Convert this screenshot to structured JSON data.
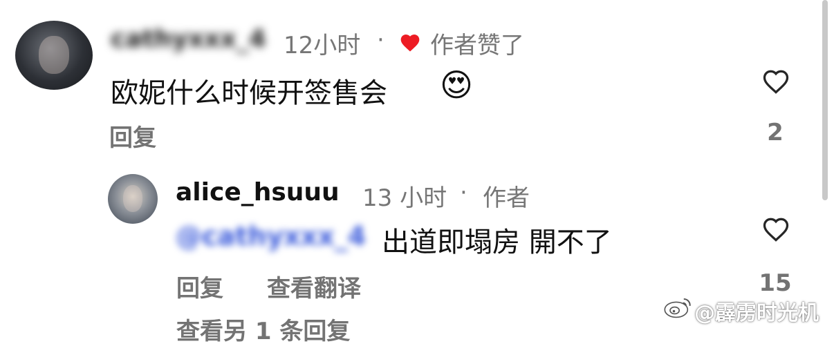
{
  "comment1": {
    "username": "cathyxxx_4",
    "time": "12小时",
    "separator": "·",
    "liked_label": "作者赞了",
    "text": "欧妮什么时候开签售会",
    "emoji": "😍",
    "reply_label": "回复",
    "like_count": "2",
    "liked_heart_color": "#ed1c24"
  },
  "reply1": {
    "username": "alice_hsuuu",
    "time": "13 小时",
    "separator": "·",
    "author_badge": "作者",
    "mention": "@cathyxxx_4",
    "text": "出道即塌房 開不了",
    "reply_label": "回复",
    "translate_label": "查看翻译",
    "like_count": "15"
  },
  "more_replies": {
    "label": "查看另 1 条回复"
  },
  "watermark": {
    "text": "@霹雳时光机"
  },
  "icons": {
    "like": "heart-outline-icon",
    "liked": "heart-filled-icon",
    "weibo": "weibo-icon"
  }
}
